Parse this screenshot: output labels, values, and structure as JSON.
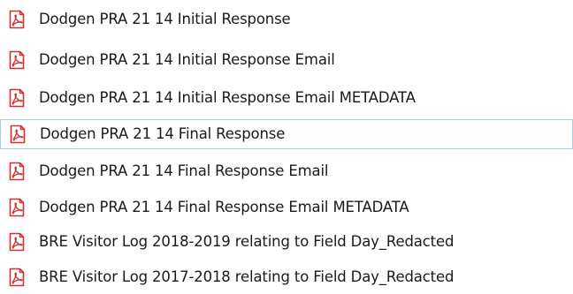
{
  "file_list": {
    "items": [
      {
        "label": "Dodgen PRA 21 14 Initial Response",
        "icon": "pdf-file-icon",
        "selected": false
      },
      {
        "label": "Dodgen PRA 21 14 Initial Response Email",
        "icon": "pdf-file-icon",
        "selected": false
      },
      {
        "label": "Dodgen PRA 21 14 Initial Response Email METADATA",
        "icon": "pdf-file-icon",
        "selected": false
      },
      {
        "label": "Dodgen PRA 21 14 Final Response",
        "icon": "pdf-file-icon",
        "selected": true
      },
      {
        "label": "Dodgen PRA 21 14 Final Response Email",
        "icon": "pdf-file-icon",
        "selected": false
      },
      {
        "label": "Dodgen PRA 21 14 Final Response Email METADATA",
        "icon": "pdf-file-icon",
        "selected": false
      },
      {
        "label": "BRE Visitor Log 2018-2019 relating to Field Day_Redacted",
        "icon": "pdf-file-icon",
        "selected": false
      },
      {
        "label": "BRE Visitor Log 2017-2018 relating to Field Day_Redacted",
        "icon": "pdf-file-icon",
        "selected": false
      }
    ]
  },
  "colors": {
    "icon_red": "#d32f2f",
    "icon_page": "#ffffff",
    "selection_border": "#99d1ff",
    "text": "#1a1a1a"
  }
}
